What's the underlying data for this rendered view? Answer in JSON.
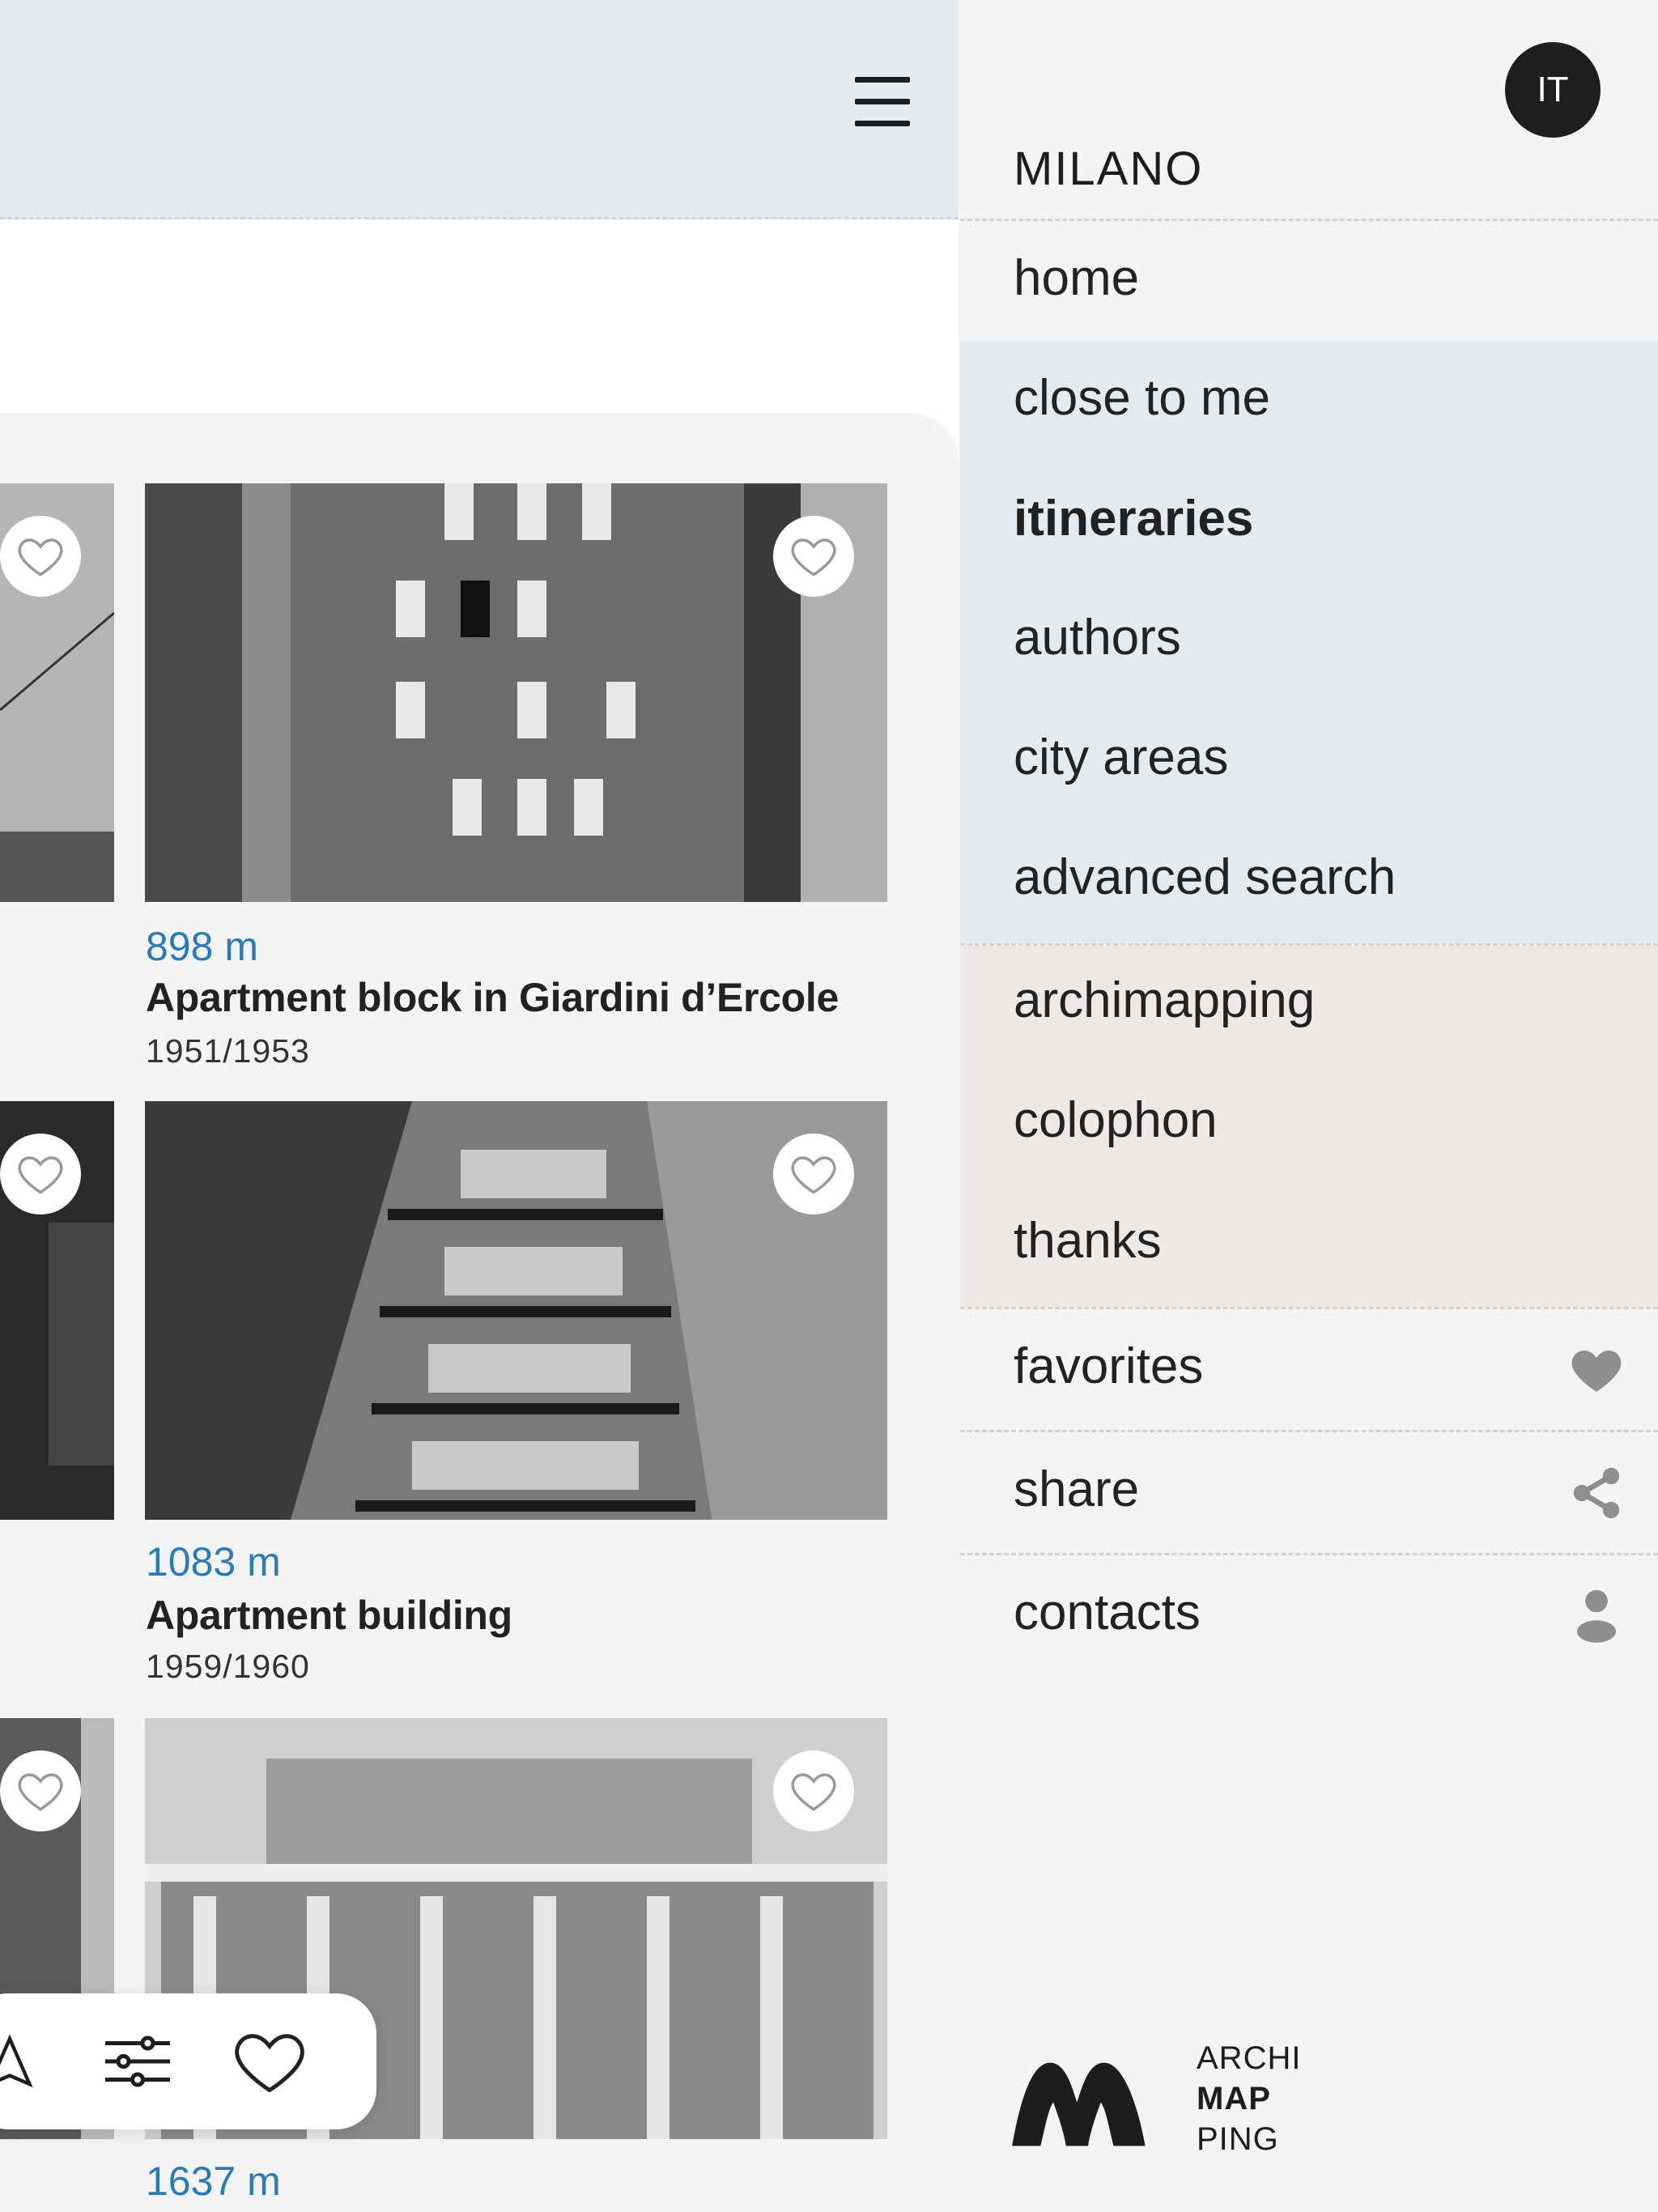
{
  "header": {
    "menu_icon": "hamburger-icon"
  },
  "cards": [
    {
      "distance": "898 m",
      "title": "Apartment block in Giardini d’Ercole",
      "years": "1951/1953"
    },
    {
      "distance": "1083 m",
      "title": "Apartment building",
      "years": "1959/1960"
    },
    {
      "distance": "1637 m",
      "title": "",
      "years": ""
    }
  ],
  "toolbar": {
    "icons": [
      "map-icon",
      "filter-sliders-icon",
      "heart-outline-icon"
    ]
  },
  "drawer": {
    "language": "IT",
    "city": "MILANO",
    "menu": {
      "home": "home",
      "close_to_me": "close to me",
      "itineraries": "itineraries",
      "authors": "authors",
      "city_areas": "city areas",
      "advanced_search": "advanced search",
      "archimapping": "archimapping",
      "colophon": "colophon",
      "thanks": "thanks",
      "favorites": "favorites",
      "share": "share",
      "contacts": "contacts"
    },
    "icons": {
      "favorites": "heart-icon",
      "share": "share-icon",
      "contacts": "person-icon"
    },
    "colors": {
      "blue_group": "#e4eaed",
      "beige_group": "#ede9e6",
      "panel": "#f4f4f4",
      "distance": "#2c7ab6"
    }
  },
  "logo": {
    "line1": "ARCHI",
    "line2": "MAP",
    "line3": "PING"
  }
}
